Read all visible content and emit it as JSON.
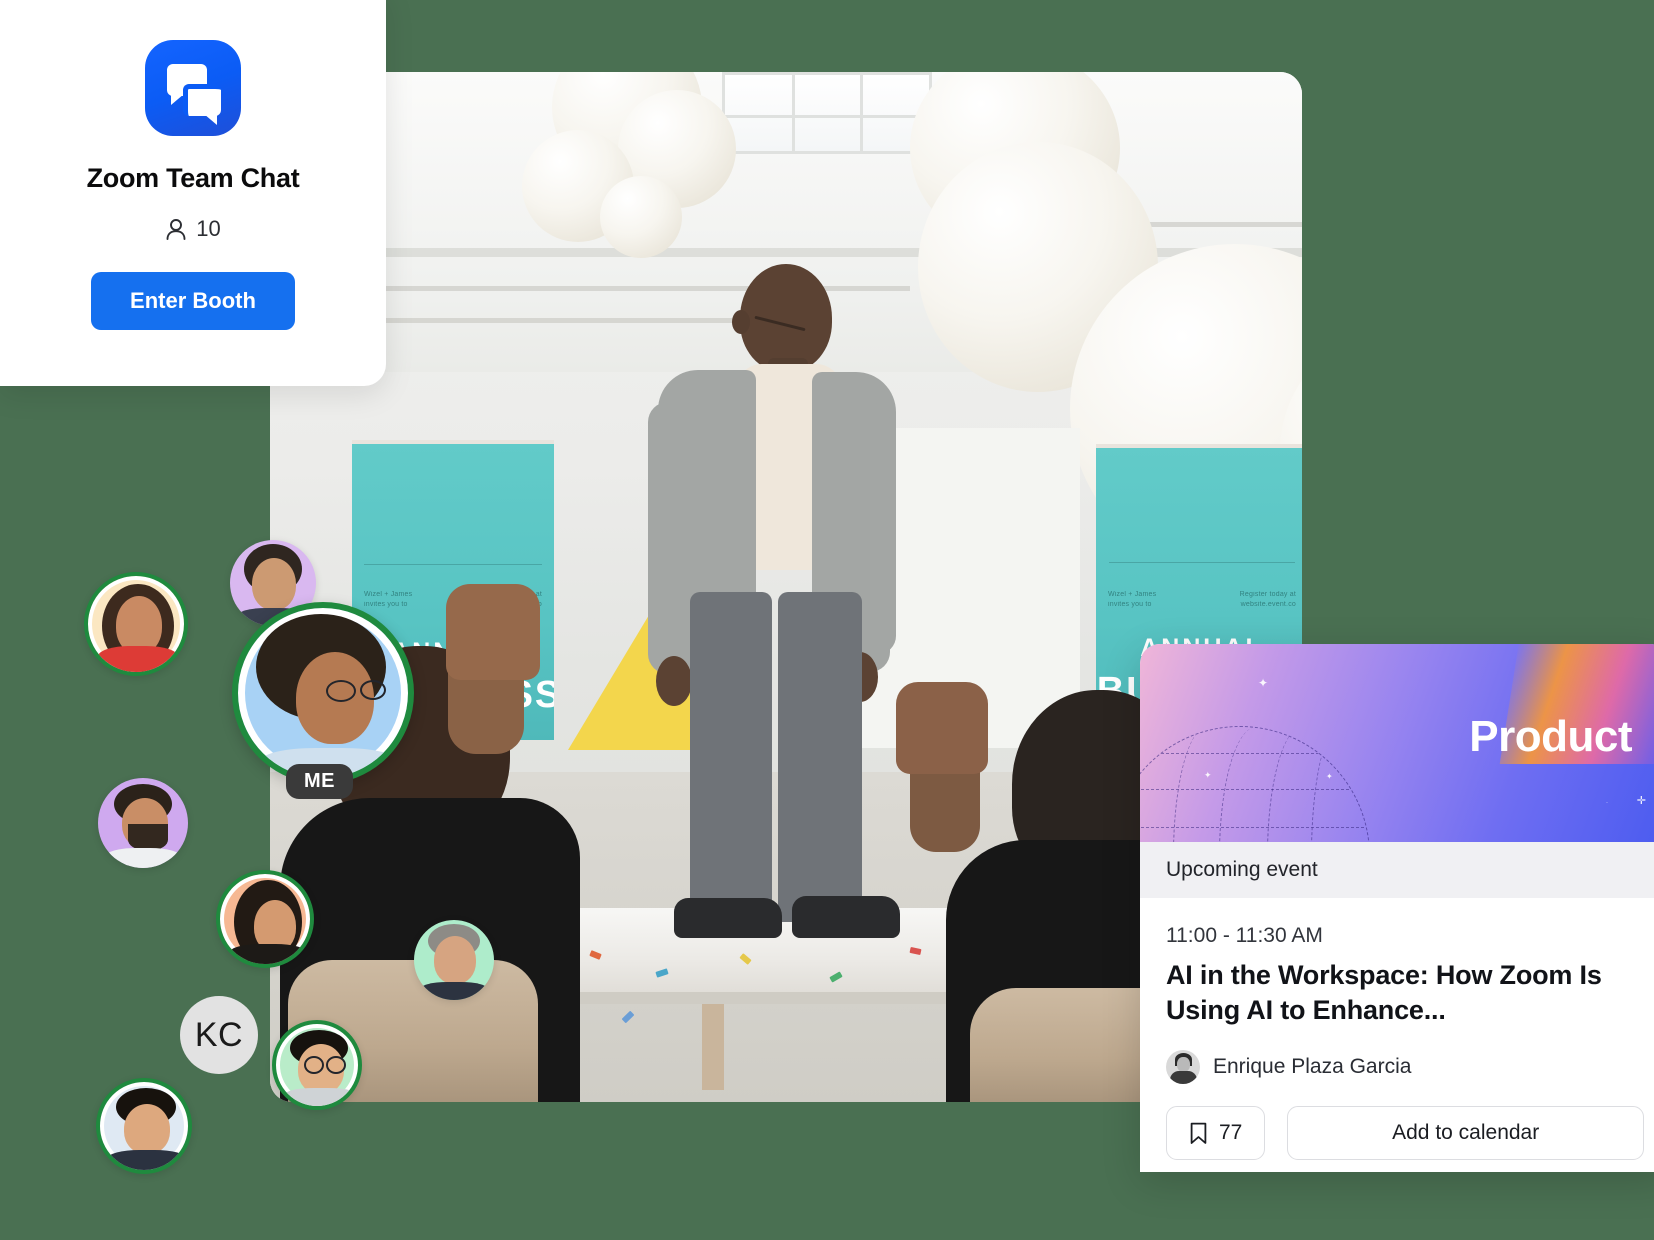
{
  "background": {
    "color": "#4a7052"
  },
  "booth_card": {
    "logo_icon": "chat-bubbles-icon",
    "title": "Zoom Team Chat",
    "participants_icon": "person-icon",
    "participants_count": "10",
    "cta_label": "Enter Booth",
    "accent_color": "#1570ef"
  },
  "stage_photo": {
    "alt": "Speaker on stage at an annual business event with seated audience applauding",
    "banner_left": {
      "eyebrow_line1": "Wizel + James",
      "eyebrow_line2": "invites you to",
      "register_line1": "Register today at",
      "register_line2": "website.event.co",
      "annual": "ANNUAL",
      "business": "BUSINESS"
    },
    "banner_right": {
      "eyebrow_line1": "Wizel + James",
      "eyebrow_line2": "invites you to",
      "register_line1": "Register today at",
      "register_line2": "website.event.co",
      "annual": "ANNUAL",
      "business": "BUSINESS"
    }
  },
  "participants": {
    "self_badge": "ME",
    "initials_avatar": "KC",
    "ring_color": "#1f8a3e",
    "items": [
      {
        "name": "participant-avatar-1",
        "label": "",
        "bg": "#fbe7c2",
        "ring": true
      },
      {
        "name": "participant-avatar-2",
        "label": "",
        "bg": "#d9b8f0",
        "ring": false
      },
      {
        "name": "participant-avatar-me",
        "label": "ME",
        "bg": "#a8d2f5",
        "ring": true
      },
      {
        "name": "participant-avatar-3",
        "label": "",
        "bg": "#cfa9ef",
        "ring": false
      },
      {
        "name": "participant-avatar-4",
        "label": "",
        "bg": "#f6b893",
        "ring": true
      },
      {
        "name": "participant-avatar-5",
        "label": "",
        "bg": "#aeeccb",
        "ring": false
      },
      {
        "name": "participant-avatar-initials",
        "label": "KC",
        "bg": "#e2e2e2",
        "ring": false
      },
      {
        "name": "participant-avatar-6",
        "label": "",
        "bg": "#b9ecc9",
        "ring": true
      },
      {
        "name": "participant-avatar-7",
        "label": "",
        "bg": "#dfe9f3",
        "ring": true
      }
    ]
  },
  "event_card": {
    "hero_label": "Product",
    "hero_icon": "wireframe-globe-icon",
    "status_label": "Upcoming event",
    "time": "11:00 - 11:30 AM",
    "title": "AI in the Workspace: How Zoom Is Using AI to Enhance...",
    "speaker": {
      "name": "Enrique Plaza Garcia",
      "avatar_icon": "speaker-avatar"
    },
    "bookmark": {
      "icon": "bookmark-icon",
      "count": "77"
    },
    "add_to_calendar_label": "Add to calendar"
  }
}
